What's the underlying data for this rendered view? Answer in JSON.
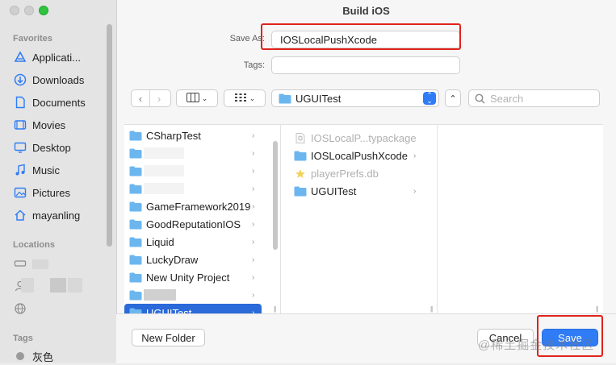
{
  "window": {
    "title": "Build iOS"
  },
  "sidebar": {
    "favorites_heading": "Favorites",
    "favorites": [
      {
        "label": "Applicati...",
        "icon": "applications-icon"
      },
      {
        "label": "Downloads",
        "icon": "downloads-icon"
      },
      {
        "label": "Documents",
        "icon": "documents-icon"
      },
      {
        "label": "Movies",
        "icon": "movies-icon"
      },
      {
        "label": "Desktop",
        "icon": "desktop-icon"
      },
      {
        "label": "Music",
        "icon": "music-icon"
      },
      {
        "label": "Pictures",
        "icon": "pictures-icon"
      },
      {
        "label": "mayanling",
        "icon": "home-icon"
      }
    ],
    "locations_heading": "Locations",
    "tags_heading": "Tags",
    "tags": [
      {
        "label": "灰色",
        "color": "#9a9a9a"
      }
    ]
  },
  "form": {
    "save_as_label": "Save As:",
    "save_as_value": "IOSLocalPushXcode",
    "tags_label": "Tags:",
    "tags_value": ""
  },
  "toolbar": {
    "back_icon": "chevron-left-icon",
    "forward_icon": "chevron-right-icon",
    "view_mode_icon": "columns-view-icon",
    "group_icon": "grid-icon",
    "current_folder": "UGUITest",
    "search_placeholder": "Search"
  },
  "browser": {
    "column1": [
      {
        "label": "CSharpTest",
        "has_children": true
      },
      {
        "label": "",
        "has_children": true
      },
      {
        "label": "",
        "has_children": true
      },
      {
        "label": "",
        "has_children": true
      },
      {
        "label": "GameFramework2019",
        "has_children": true
      },
      {
        "label": "GoodReputationIOS",
        "has_children": true
      },
      {
        "label": "Liquid",
        "has_children": true
      },
      {
        "label": "LuckyDraw",
        "has_children": true
      },
      {
        "label": "New Unity Project",
        "has_children": true
      },
      {
        "label": "",
        "has_children": true
      },
      {
        "label": "UGUITest",
        "has_children": true,
        "selected": true
      }
    ],
    "column2": [
      {
        "label": "IOSLocalP...typackage",
        "kind": "package",
        "dim": true,
        "has_children": false
      },
      {
        "label": "IOSLocalPushXcode",
        "kind": "folder",
        "dim": false,
        "has_children": true
      },
      {
        "label": "playerPrefs.db",
        "kind": "db",
        "dim": true,
        "has_children": false
      },
      {
        "label": "UGUITest",
        "kind": "folder",
        "dim": false,
        "has_children": true
      }
    ]
  },
  "buttons": {
    "new_folder": "New Folder",
    "cancel": "Cancel",
    "save": "Save"
  },
  "watermark": "@稀土掘金技术社区",
  "colors": {
    "accent": "#2f7cf6",
    "selection": "#2a6ad9",
    "highlight_box": "#e0231b",
    "folder": "#6cb6f0"
  }
}
